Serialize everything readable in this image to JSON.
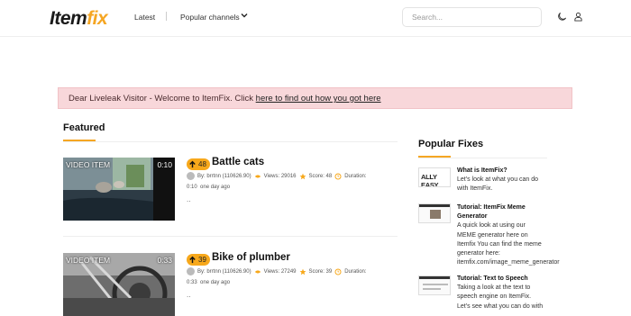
{
  "header": {
    "logo_main": "Item",
    "logo_accent": "fix",
    "nav_latest": "Latest",
    "nav_channels": "Popular channels",
    "search_placeholder": "Search..."
  },
  "alert": {
    "text": "Dear Liveleak Visitor - Welcome to ItemFix. Click ",
    "link": "here to find out how you got here"
  },
  "featured": {
    "title": "Featured",
    "videos": [
      {
        "tag": "VIDEO ITEM",
        "duration": "0:10",
        "votes": "48",
        "title": "Battle cats",
        "author": "By: brrtnn (110626.90)",
        "views": "Views: 29016",
        "score": "Score: 48",
        "duration_label": "Duration:",
        "duration_value": "0:10",
        "age": "one day ago",
        "dots": ".."
      },
      {
        "tag": "VIDEO ITEM",
        "duration": "0:33",
        "votes": "39",
        "title": "Bike of plumber",
        "author": "By: brrtnn (110626.90)",
        "views": "Views: 27249",
        "score": "Score: 39",
        "duration_label": "Duration:",
        "duration_value": "0:33",
        "age": "one day ago",
        "dots": ".."
      }
    ]
  },
  "popular": {
    "title": "Popular Fixes",
    "thumb1_text": "ALLY EASY",
    "items": [
      {
        "title": "What is ItemFix?",
        "lines": [
          "Let's look at what you can do",
          "with ItemFix."
        ]
      },
      {
        "title": "Tutorial: ItemFix Meme",
        "title2": "Generator",
        "lines": [
          "A quick look at using our",
          "MEME generator here on",
          "Itemfix You can find the meme",
          "generator here:",
          "itemfix.com/image_meme_generator"
        ]
      },
      {
        "title": "Tutorial: Text to Speech",
        "lines": [
          "Taking a look at the text to",
          "speech engine on ItemFix.",
          "Let's see what you can do with"
        ]
      }
    ]
  },
  "colors": {
    "accent": "#f5a623",
    "vote": "#f7a81b",
    "alert_bg": "#f8d7da"
  },
  "icons": [
    "chevron-down-icon",
    "moon-icon",
    "user-icon",
    "arrow-up-icon",
    "avatar-icon",
    "eye-icon",
    "star-icon",
    "clock-icon"
  ]
}
